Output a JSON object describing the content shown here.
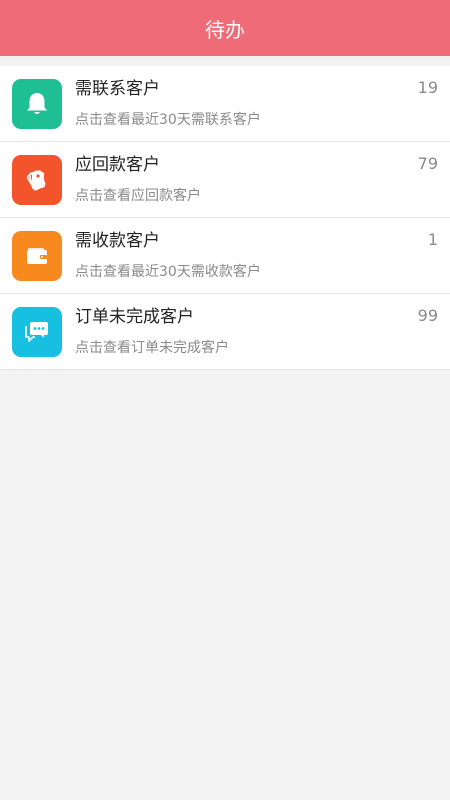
{
  "header": {
    "title": "待办"
  },
  "items": [
    {
      "title": "需联系客户",
      "subtitle": "点击查看最近30天需联系客户",
      "count": "19",
      "icon": "bell-icon",
      "color": "#1fbf95"
    },
    {
      "title": "应回款客户",
      "subtitle": "点击查看应回款客户",
      "count": "79",
      "icon": "tags-icon",
      "color": "#f4542b"
    },
    {
      "title": "需收款客户",
      "subtitle": "点击查看最近30天需收款客户",
      "count": "1",
      "icon": "wallet-icon",
      "color": "#f7891f"
    },
    {
      "title": "订单未完成客户",
      "subtitle": "点击查看订单未完成客户",
      "count": "99",
      "icon": "chat-icon",
      "color": "#17bfe0"
    }
  ]
}
